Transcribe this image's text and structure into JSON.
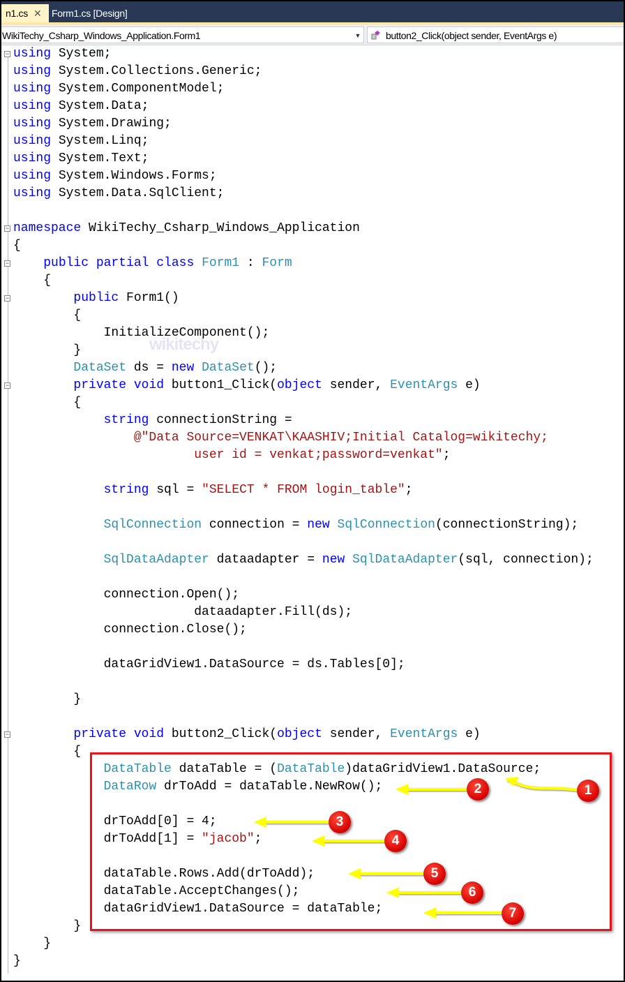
{
  "tabs": {
    "active_label": "n1.cs",
    "close_glyph": "✕",
    "design_label": "Form1.cs [Design]"
  },
  "nav": {
    "class_dropdown": "WikiTechy_Csharp_Windows_Application.Form1",
    "member_dropdown": "button2_Click(object sender, EventArgs e)",
    "dropdown_arrow": "▼"
  },
  "watermark": "wikitechy",
  "colors": {
    "keyword": "#0000ff",
    "type": "#2b91af",
    "string": "#a31515",
    "highlight_box": "#e8141b",
    "arrow": "#ffff00",
    "badge": "#d40000"
  },
  "code": [
    [
      [
        "k",
        "using"
      ],
      [
        "n",
        " System;"
      ]
    ],
    [
      [
        "k",
        "using"
      ],
      [
        "n",
        " System.Collections.Generic;"
      ]
    ],
    [
      [
        "k",
        "using"
      ],
      [
        "n",
        " System.ComponentModel;"
      ]
    ],
    [
      [
        "k",
        "using"
      ],
      [
        "n",
        " System.Data;"
      ]
    ],
    [
      [
        "k",
        "using"
      ],
      [
        "n",
        " System.Drawing;"
      ]
    ],
    [
      [
        "k",
        "using"
      ],
      [
        "n",
        " System.Linq;"
      ]
    ],
    [
      [
        "k",
        "using"
      ],
      [
        "n",
        " System.Text;"
      ]
    ],
    [
      [
        "k",
        "using"
      ],
      [
        "n",
        " System.Windows.Forms;"
      ]
    ],
    [
      [
        "k",
        "using"
      ],
      [
        "n",
        " System.Data.SqlClient;"
      ]
    ],
    [],
    [
      [
        "k",
        "namespace"
      ],
      [
        "n",
        " WikiTechy_Csharp_Windows_Application"
      ]
    ],
    [
      [
        "n",
        "{"
      ]
    ],
    [
      [
        "n",
        "    "
      ],
      [
        "k",
        "public partial class"
      ],
      [
        "n",
        " "
      ],
      [
        "y",
        "Form1"
      ],
      [
        "n",
        " : "
      ],
      [
        "y",
        "Form"
      ]
    ],
    [
      [
        "n",
        "    {"
      ]
    ],
    [
      [
        "n",
        "        "
      ],
      [
        "k",
        "public"
      ],
      [
        "n",
        " Form1()"
      ]
    ],
    [
      [
        "n",
        "        {"
      ]
    ],
    [
      [
        "n",
        "            InitializeComponent();"
      ]
    ],
    [
      [
        "n",
        "        }"
      ]
    ],
    [
      [
        "n",
        "        "
      ],
      [
        "y",
        "DataSet"
      ],
      [
        "n",
        " ds = "
      ],
      [
        "k",
        "new"
      ],
      [
        "n",
        " "
      ],
      [
        "y",
        "DataSet"
      ],
      [
        "n",
        "();"
      ]
    ],
    [
      [
        "n",
        "        "
      ],
      [
        "k",
        "private void"
      ],
      [
        "n",
        " button1_Click("
      ],
      [
        "k",
        "object"
      ],
      [
        "n",
        " sender, "
      ],
      [
        "y",
        "EventArgs"
      ],
      [
        "n",
        " e)"
      ]
    ],
    [
      [
        "n",
        "        {"
      ]
    ],
    [
      [
        "n",
        "            "
      ],
      [
        "k",
        "string"
      ],
      [
        "n",
        " connectionString ="
      ]
    ],
    [
      [
        "n",
        "                "
      ],
      [
        "s",
        "@\"Data Source=VENKAT\\KAASHIV;Initial Catalog=wikitechy;"
      ]
    ],
    [
      [
        "s",
        "                        user id = venkat;password=venkat\""
      ],
      [
        "n",
        ";"
      ]
    ],
    [],
    [
      [
        "n",
        "            "
      ],
      [
        "k",
        "string"
      ],
      [
        "n",
        " sql = "
      ],
      [
        "s",
        "\"SELECT * FROM login_table\""
      ],
      [
        "n",
        ";"
      ]
    ],
    [],
    [
      [
        "n",
        "            "
      ],
      [
        "y",
        "SqlConnection"
      ],
      [
        "n",
        " connection = "
      ],
      [
        "k",
        "new"
      ],
      [
        "n",
        " "
      ],
      [
        "y",
        "SqlConnection"
      ],
      [
        "n",
        "(connectionString);"
      ]
    ],
    [],
    [
      [
        "n",
        "            "
      ],
      [
        "y",
        "SqlDataAdapter"
      ],
      [
        "n",
        " dataadapter = "
      ],
      [
        "k",
        "new"
      ],
      [
        "n",
        " "
      ],
      [
        "y",
        "SqlDataAdapter"
      ],
      [
        "n",
        "(sql, connection);"
      ]
    ],
    [],
    [
      [
        "n",
        "            connection.Open();"
      ]
    ],
    [
      [
        "n",
        "                        dataadapter.Fill(ds);"
      ]
    ],
    [
      [
        "n",
        "            connection.Close();"
      ]
    ],
    [],
    [
      [
        "n",
        "            dataGridView1.DataSource = ds.Tables[0];"
      ]
    ],
    [],
    [
      [
        "n",
        "        }"
      ]
    ],
    [],
    [
      [
        "n",
        "        "
      ],
      [
        "k",
        "private void"
      ],
      [
        "n",
        " button2_Click("
      ],
      [
        "k",
        "object"
      ],
      [
        "n",
        " sender, "
      ],
      [
        "y",
        "EventArgs"
      ],
      [
        "n",
        " e)"
      ]
    ],
    [
      [
        "n",
        "        {"
      ]
    ],
    [
      [
        "n",
        "            "
      ],
      [
        "y",
        "DataTable"
      ],
      [
        "n",
        " dataTable = ("
      ],
      [
        "y",
        "DataTable"
      ],
      [
        "n",
        ")dataGridView1.DataSource;"
      ]
    ],
    [
      [
        "n",
        "            "
      ],
      [
        "y",
        "DataRow"
      ],
      [
        "n",
        " drToAdd = dataTable.NewRow();"
      ]
    ],
    [],
    [
      [
        "n",
        "            drToAdd[0] = 4;"
      ]
    ],
    [
      [
        "n",
        "            drToAdd[1] = "
      ],
      [
        "s",
        "\"jacob\""
      ],
      [
        "n",
        ";"
      ]
    ],
    [],
    [
      [
        "n",
        "            dataTable.Rows.Add(drToAdd);"
      ]
    ],
    [
      [
        "n",
        "            dataTable.AcceptChanges();"
      ]
    ],
    [
      [
        "n",
        "            dataGridView1.DataSource = dataTable;"
      ]
    ],
    [
      [
        "n",
        "        }"
      ]
    ],
    [
      [
        "n",
        "    }"
      ]
    ],
    [
      [
        "n",
        "}"
      ]
    ]
  ],
  "annotations": [
    {
      "number": "1"
    },
    {
      "number": "2"
    },
    {
      "number": "3"
    },
    {
      "number": "4"
    },
    {
      "number": "5"
    },
    {
      "number": "6"
    },
    {
      "number": "7"
    }
  ]
}
